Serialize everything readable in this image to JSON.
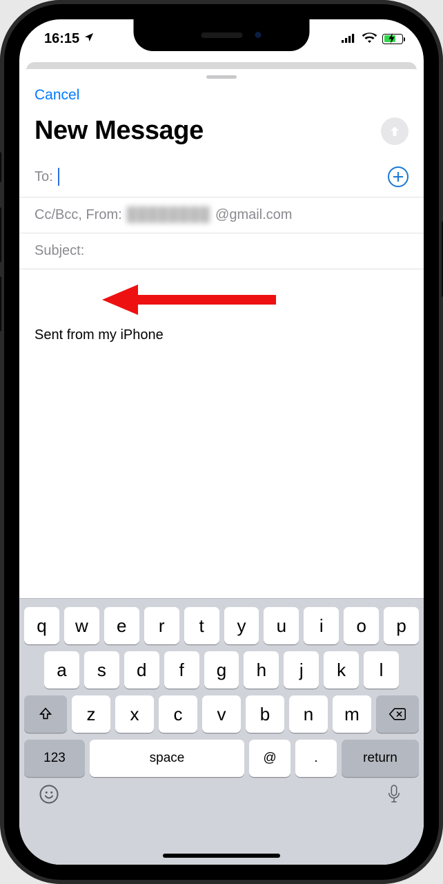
{
  "status": {
    "time": "16:15"
  },
  "nav": {
    "cancel": "Cancel"
  },
  "compose": {
    "title": "New Message",
    "to_label": "To:",
    "ccbcc_from_label": "Cc/Bcc, From:",
    "from_domain": "@gmail.com",
    "subject_label": "Subject:",
    "signature": "Sent from my iPhone"
  },
  "keyboard": {
    "row1": [
      "q",
      "w",
      "e",
      "r",
      "t",
      "y",
      "u",
      "i",
      "o",
      "p"
    ],
    "row2": [
      "a",
      "s",
      "d",
      "f",
      "g",
      "h",
      "j",
      "k",
      "l"
    ],
    "row3": [
      "z",
      "x",
      "c",
      "v",
      "b",
      "n",
      "m"
    ],
    "numLabel": "123",
    "spaceLabel": "space",
    "atLabel": "@",
    "dotLabel": ".",
    "returnLabel": "return"
  }
}
